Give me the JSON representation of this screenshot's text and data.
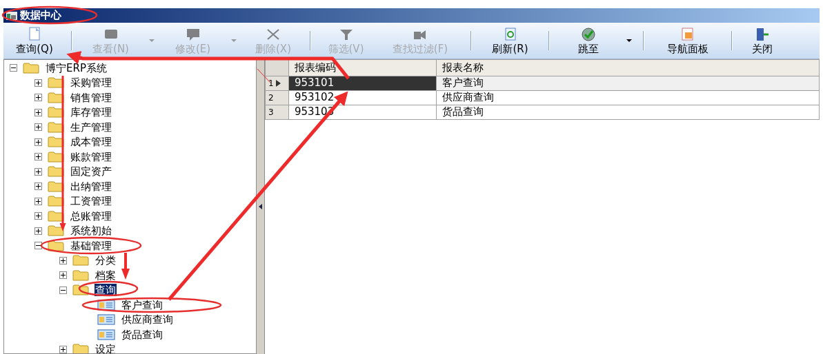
{
  "window": {
    "title": "数据中心"
  },
  "toolbar": [
    {
      "label": "查询(Q)",
      "disabled": false,
      "dropdown": false,
      "separator_after": true
    },
    {
      "label": "查看(N)",
      "disabled": true,
      "dropdown": true,
      "separator_after": false
    },
    {
      "label": "修改(E)",
      "disabled": true,
      "dropdown": true,
      "separator_after": false
    },
    {
      "label": "删除(X)",
      "disabled": true,
      "dropdown": false,
      "separator_after": true
    },
    {
      "label": "筛选(V)",
      "disabled": true,
      "dropdown": false,
      "separator_after": false
    },
    {
      "label": "查找过滤(F)",
      "disabled": true,
      "dropdown": false,
      "separator_after": true
    },
    {
      "label": "刷新(R)",
      "disabled": false,
      "dropdown": false,
      "separator_after": true
    },
    {
      "label": "跳至",
      "disabled": false,
      "dropdown": true,
      "separator_after": true
    },
    {
      "label": "导航面板",
      "disabled": false,
      "dropdown": false,
      "separator_after": true
    },
    {
      "label": "关闭",
      "disabled": false,
      "dropdown": false,
      "separator_after": false
    }
  ],
  "tree": [
    {
      "label": "博宁ERP系统",
      "kind": "folder",
      "expanded": true,
      "selected": false,
      "children": [
        {
          "label": "采购管理",
          "kind": "folder",
          "expanded": false,
          "selected": false
        },
        {
          "label": "销售管理",
          "kind": "folder",
          "expanded": false,
          "selected": false
        },
        {
          "label": "库存管理",
          "kind": "folder",
          "expanded": false,
          "selected": false
        },
        {
          "label": "生产管理",
          "kind": "folder",
          "expanded": false,
          "selected": false
        },
        {
          "label": "成本管理",
          "kind": "folder",
          "expanded": false,
          "selected": false
        },
        {
          "label": "账款管理",
          "kind": "folder",
          "expanded": false,
          "selected": false
        },
        {
          "label": "固定资产",
          "kind": "folder",
          "expanded": false,
          "selected": false
        },
        {
          "label": "出纳管理",
          "kind": "folder",
          "expanded": false,
          "selected": false
        },
        {
          "label": "工资管理",
          "kind": "folder",
          "expanded": false,
          "selected": false
        },
        {
          "label": "总账管理",
          "kind": "folder",
          "expanded": false,
          "selected": false
        },
        {
          "label": "系统初始",
          "kind": "folder",
          "expanded": false,
          "selected": false
        },
        {
          "label": "基础管理",
          "kind": "folder",
          "expanded": true,
          "selected": false,
          "children": [
            {
              "label": "分类",
              "kind": "folder",
              "expanded": false,
              "selected": false
            },
            {
              "label": "档案",
              "kind": "folder",
              "expanded": false,
              "selected": false
            },
            {
              "label": "查询",
              "kind": "folder",
              "expanded": true,
              "selected": true,
              "children": [
                {
                  "label": "客户查询",
                  "kind": "report",
                  "selected": false
                },
                {
                  "label": "供应商查询",
                  "kind": "report",
                  "selected": false
                },
                {
                  "label": "货品查询",
                  "kind": "report",
                  "selected": false
                }
              ]
            },
            {
              "label": "设定",
              "kind": "folder",
              "expanded": false,
              "selected": false
            }
          ]
        }
      ]
    }
  ],
  "grid": {
    "columns": [
      "报表编码",
      "报表名称"
    ],
    "rows": [
      {
        "number": "1",
        "cells": [
          "953101",
          "客户查询"
        ],
        "selected": true
      },
      {
        "number": "2",
        "cells": [
          "953102",
          "供应商查询"
        ],
        "selected": false
      },
      {
        "number": "3",
        "cells": [
          "953103",
          "货品查询"
        ],
        "selected": false
      }
    ]
  }
}
